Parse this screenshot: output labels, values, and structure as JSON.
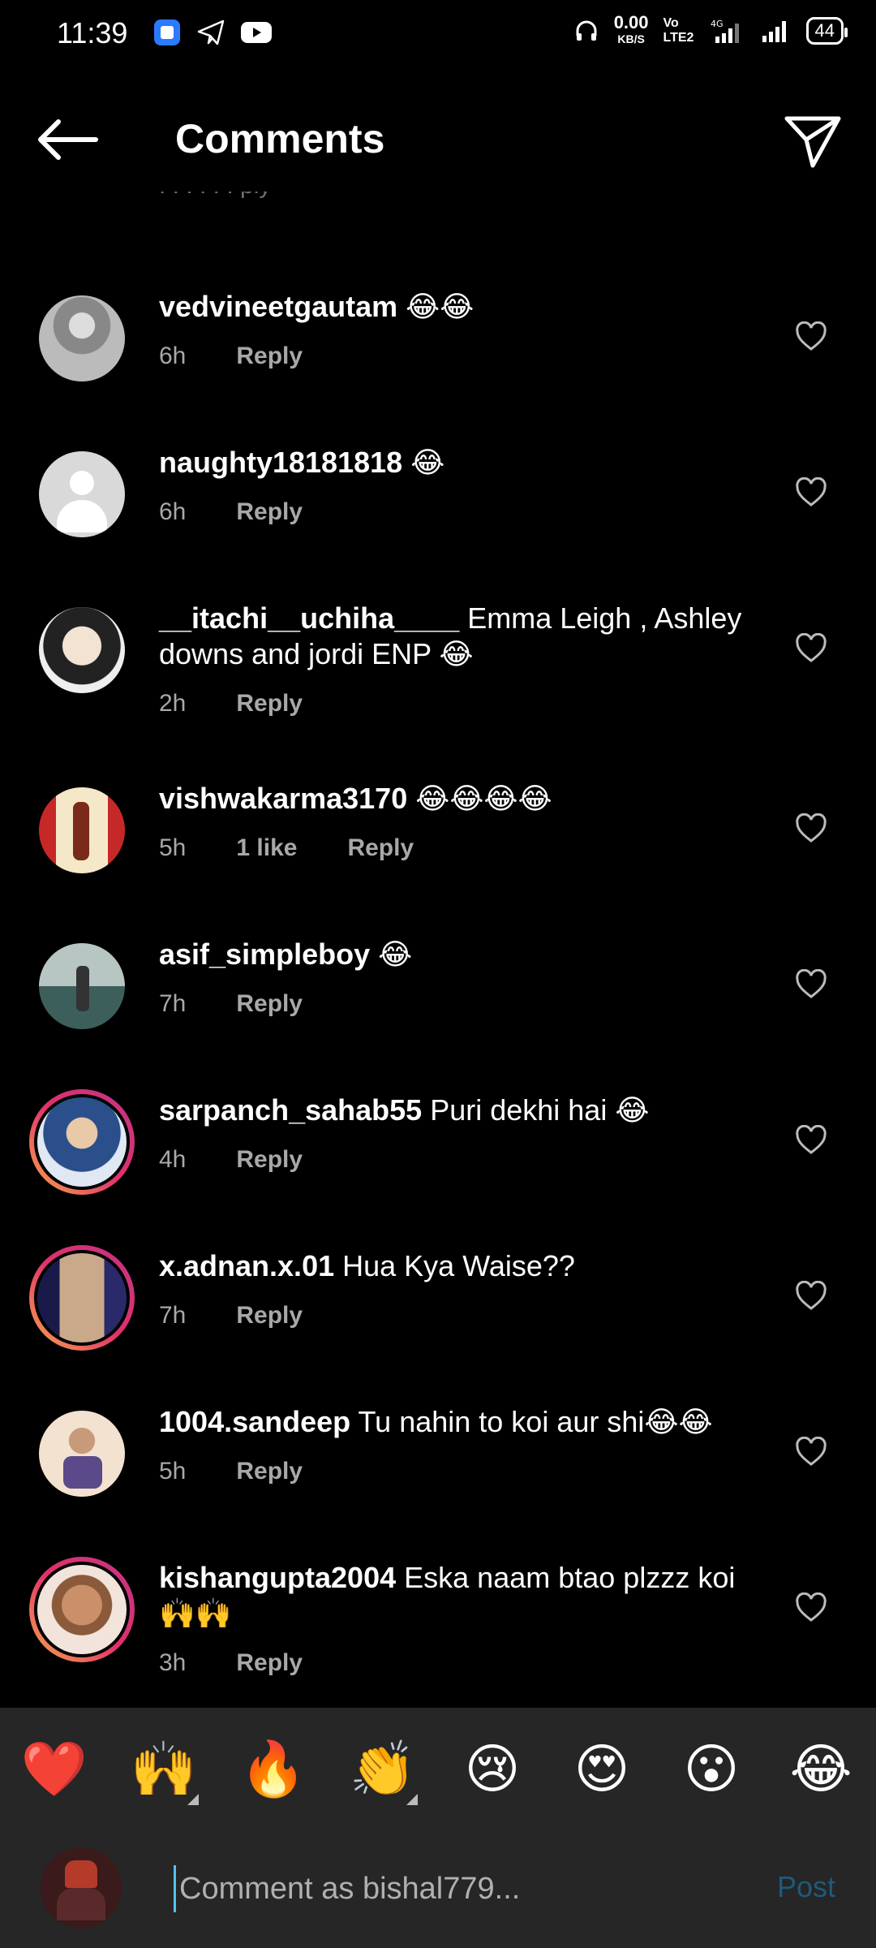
{
  "status_bar": {
    "time": "11:39",
    "net_speed_value": "0.00",
    "net_speed_unit": "KB/S",
    "volte": "Vo LTE2",
    "network": "4G",
    "battery": "44"
  },
  "header": {
    "title": "Comments"
  },
  "comments": [
    {
      "username": "vedvineetgautam",
      "text": "😂😂",
      "time": "6h",
      "likes": "",
      "reply": "Reply"
    },
    {
      "username": "naughty18181818",
      "text": "😂",
      "time": "6h",
      "likes": "",
      "reply": "Reply"
    },
    {
      "username": "__itachi__uchiha____",
      "text": "Emma Leigh , Ashley downs and jordi ENP 😂",
      "time": "2h",
      "likes": "",
      "reply": "Reply"
    },
    {
      "username": "vishwakarma3170",
      "text": "😂😂😂😂",
      "time": "5h",
      "likes": "1 like",
      "reply": "Reply"
    },
    {
      "username": "asif_simpleboy",
      "text": "😂",
      "time": "7h",
      "likes": "",
      "reply": "Reply"
    },
    {
      "username": "sarpanch_sahab55",
      "text": "Puri dekhi hai 😂",
      "time": "4h",
      "likes": "",
      "reply": "Reply"
    },
    {
      "username": "x.adnan.x.01",
      "text": "Hua Kya Waise??",
      "time": "7h",
      "likes": "",
      "reply": "Reply"
    },
    {
      "username": "1004.sandeep",
      "text": "Tu nahin to koi aur shi😂😂",
      "time": "5h",
      "likes": "",
      "reply": "Reply"
    },
    {
      "username": "kishangupta2004",
      "text": "Eska naam btao plzzz koi 🙌🙌",
      "time": "3h",
      "likes": "",
      "reply": "Reply"
    }
  ],
  "emoji_bar": [
    "❤️",
    "🙌",
    "🔥",
    "👏",
    "😢",
    "😍",
    "😮",
    "😂"
  ],
  "input": {
    "placeholder": "Comment as bishal779...",
    "post_label": "Post"
  },
  "colors": {
    "background": "#000000",
    "secondary_text": "#a8a8a8",
    "post_button": "#1e5a7a",
    "story_ring_start": "#f6a94b",
    "story_ring_end": "#c13584"
  }
}
